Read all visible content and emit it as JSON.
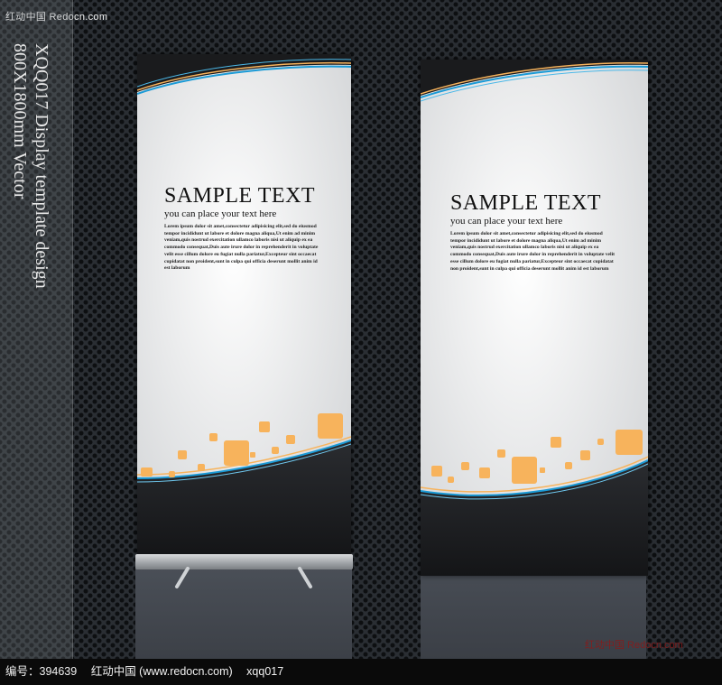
{
  "watermark": {
    "top_left": "红动中国 Redocn.com",
    "bottom_right": "红动中国 Redocn.com"
  },
  "sidebar": {
    "line1": "XQQ017 Display template design",
    "line2": "800X1800mm Vector"
  },
  "banners": [
    {
      "headline": "SAMPLE TEXT",
      "subhead": "you can place your text here",
      "body": "Lorem ipsum dolor sit amet,consectetur adipisicing elit,sed do eiusmod tempor incididunt ut labore et dolore magna aliqua,Ut enim ad minim veniam,quis nostrud exercitation ullamco laboris nisi ut aliquip ex ea commodo consequat,Duis aute irure dolor in reprehenderit in voluptate velit esse cillum dolore eu fugiat nulla pariatur,Excepteur sint occaecat cupidatat non proident,sunt in culpa qui officia deserunt mollit anim id est laborum"
    },
    {
      "headline": "SAMPLE TEXT",
      "subhead": "you can place your text here",
      "body": "Lorem ipsum dolor sit amet,consectetur adipisicing elit,sed do eiusmod tempor incididunt ut labore et dolore magna aliqua,Ut enim ad minim veniam,quis nostrud exercitation ullamco laboris nisi ut aliquip ex ea commodo consequat,Duis aute irure dolor in reprehenderit in voluptate velit esse cillum dolore eu fugiat nulla pariatur,Excepteur sint occaecat cupidatat non proident,sunt in culpa qui officia deserunt mollit anim id est laborum"
    }
  ],
  "footer": {
    "id_label": "编号：394639",
    "site": "红动中国 (www.redocn.com)",
    "code": "xqq017"
  },
  "colors": {
    "accent_orange": "#f7b35c",
    "accent_blue": "#1a9ad6",
    "dark_panel": "#1f2124"
  }
}
